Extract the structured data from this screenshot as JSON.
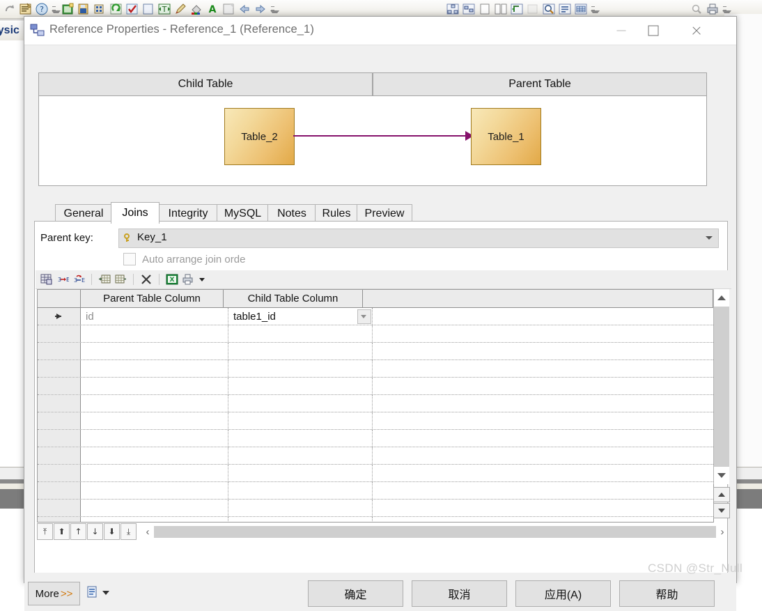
{
  "background": {
    "tab_label": "hysic",
    "toolbar_icons": [
      "redo-icon",
      "properties-icon",
      "help-icon",
      "overflow-icon",
      "new-model-icon",
      "save-model-icon",
      "find-icon",
      "refresh-icon",
      "check-model-icon",
      "note-icon",
      "text-tool-icon",
      "pencil-icon",
      "fill-color-icon",
      "font-color-icon",
      "shape-icon",
      "back-arrow-icon",
      "forward-arrow-icon",
      "diagram-icon",
      "subdiagram-icon",
      "page-icon",
      "pages-icon",
      "link-diagram-icon",
      "preview-disabled-icon",
      "zoom-icon",
      "report-icon",
      "grid-report-icon",
      "print-preview-icon",
      "print-icon"
    ]
  },
  "window": {
    "title": "Reference Properties - Reference_1 (Reference_1)",
    "icon": "reference-icon",
    "minimize_label": "",
    "maximize_label": "",
    "close_label": ""
  },
  "diagram": {
    "child_header": "Child Table",
    "parent_header": "Parent Table",
    "child_table": "Table_2",
    "parent_table": "Table_1",
    "link_color": "#86126b",
    "box_color": "#edc071"
  },
  "tabs": [
    {
      "label": "General",
      "active": false
    },
    {
      "label": "Joins",
      "active": true
    },
    {
      "label": "Integrity",
      "active": false
    },
    {
      "label": "MySQL",
      "active": false
    },
    {
      "label": "Notes",
      "active": false
    },
    {
      "label": "Rules",
      "active": false
    },
    {
      "label": "Preview",
      "active": false
    }
  ],
  "joins": {
    "parent_key_label": "Parent key:",
    "parent_key_value": "Key_1",
    "parent_key_icon": "key-icon",
    "auto_arrange_label": "Auto arrange join orde",
    "auto_arrange_checked": false,
    "toolbar_icons": [
      "grid-properties-icon",
      "insert-column-icon",
      "replace-column-icon",
      "insert-row-above-icon",
      "insert-row-below-icon",
      "delete-row-icon",
      "export-excel-icon",
      "print-grid-icon",
      "dropdown-icon"
    ],
    "columns": [
      "",
      "Parent Table Column",
      "Child Table Column",
      ""
    ],
    "rows": [
      {
        "marker": "current-row-marker",
        "parent_column": "id",
        "child_column": "table1_id",
        "has_dropdown": true
      }
    ],
    "empty_row_count": 12,
    "nav_buttons": [
      "first-row",
      "prev-page",
      "prev-row",
      "next-row",
      "next-page",
      "last-row"
    ],
    "scroll_left_label": "‹",
    "scroll_right_label": "›"
  },
  "footer": {
    "more_label": "More",
    "more_chevrons": ">>",
    "script_icon": "script-icon",
    "buttons": [
      {
        "label": "确定",
        "name": "ok-button"
      },
      {
        "label": "取消",
        "name": "cancel-button"
      },
      {
        "label": "应用(A)",
        "name": "apply-button"
      },
      {
        "label": "帮助",
        "name": "help-button"
      }
    ]
  },
  "watermark": "CSDN @Str_Null"
}
